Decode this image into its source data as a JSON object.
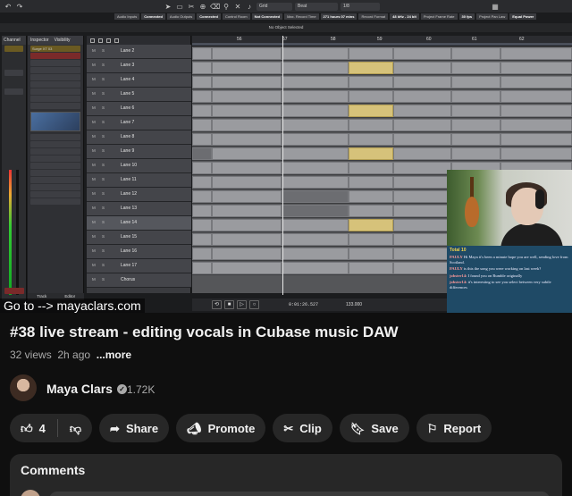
{
  "video": {
    "status_chips": [
      "Audio Inputs",
      "Connected",
      "Audio Outputs",
      "Connected",
      "Control Room",
      "Not Connected",
      "Max. Record Time",
      "271 hours 07 mins",
      "Record Format",
      "48 kHz - 24 bit",
      "Project Frame Rate",
      "30 fps",
      "Project Pan Law",
      "Equal Power"
    ],
    "toolbar": {
      "grid": "Grid",
      "beat": "Beat",
      "quant": "1/8"
    },
    "object_info": "No Object Selected",
    "inspector": {
      "tabs": [
        "Inspector",
        "Visibility"
      ],
      "track_name": "Surge XT 03",
      "bottom_tabs": [
        "Track",
        "Editor"
      ]
    },
    "channel_label": "Channel",
    "lanes": [
      "Lane 2",
      "Lane 3",
      "Lane 4",
      "Lane 5",
      "Lane 6",
      "Lane 7",
      "Lane 8",
      "Lane 9",
      "Lane 10",
      "Lane 11",
      "Lane 12",
      "Lane 13",
      "Lane 14",
      "Lane 15",
      "Lane 16",
      "Lane 17",
      "Chorus"
    ],
    "ruler_bars": [
      "56",
      "57",
      "58",
      "59",
      "60",
      "61",
      "62"
    ],
    "timecode": "0:01:26.527",
    "tempo": "133.000",
    "overlay_text": "Go to  -->  mayaclars.com",
    "chat": {
      "total": "Total 10",
      "messages": [
        {
          "user": "PAULY",
          "text": "Hi Maya it's been a minute hope you are well, sending love from Scotland."
        },
        {
          "user": "PAULY",
          "text": "is this the song you were working on last week?"
        },
        {
          "user": "jobster14:",
          "text": "I found you on Rumble originally"
        },
        {
          "user": "jobster14:",
          "text": "it's interesting to see you select between very subtle differences"
        }
      ]
    }
  },
  "title": "#38 live stream - editing vocals in Cubase music DAW",
  "meta": {
    "views": "32 views",
    "age": "2h ago",
    "more": "...more"
  },
  "channel": {
    "name": "Maya Clars",
    "subscribers": "1.72K"
  },
  "actions": {
    "likes": "4",
    "share": "Share",
    "promote": "Promote",
    "clip": "Clip",
    "save": "Save",
    "report": "Report"
  },
  "comments": {
    "header": "Comments"
  },
  "colors": {
    "page_bg": "#0f0f0f",
    "pill_bg": "#272727",
    "clip_highlight": "#d6c27a",
    "chat_bg": "#1f4a66"
  }
}
